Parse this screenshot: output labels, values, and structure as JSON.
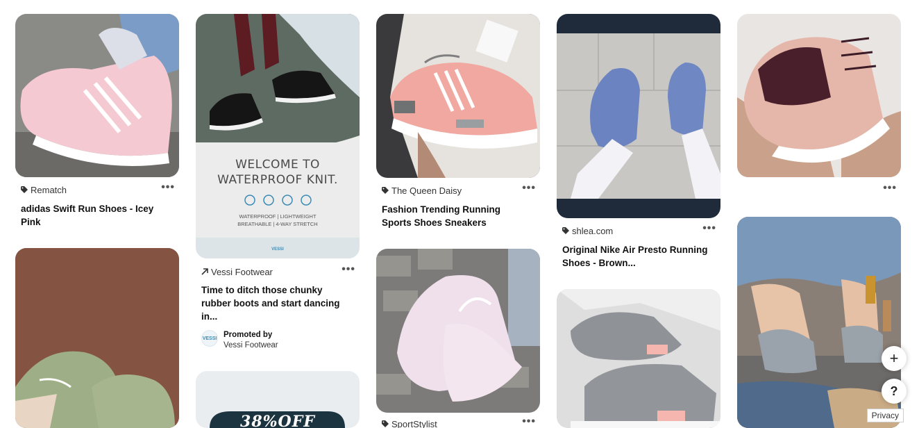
{
  "pins": [
    {
      "source": "Rematch",
      "title": "adidas Swift Run Shoes - Icey Pink"
    },
    {
      "source": "Vessi Footwear",
      "title": "Time to ditch those chunky rubber boots and start dancing in...",
      "promoted_label": "Promoted by",
      "promoted_by": "Vessi Footwear",
      "ad_heading": "WELCOME TO WATERPROOF KNIT.",
      "ad_features": "WATERPROOF | LIGHTWEIGHT BREATHABLE | 4-WAY STRETCH",
      "ad_logo": "VESSI"
    },
    {
      "source": "The Queen Daisy",
      "title": "Fashion Trending Running Sports Shoes Sneakers"
    },
    {
      "source": "shlea.com",
      "title": "Original Nike Air Presto Running Shoes - Brown..."
    },
    {
      "source": "SportStylist",
      "title": ""
    },
    {
      "promo_text": "38%OFF"
    }
  ],
  "controls": {
    "more": "•••",
    "add": "+",
    "help": "?",
    "privacy": "Privacy"
  },
  "icons": [
    "tag-icon",
    "external-link-icon",
    "more-icon",
    "plus-icon",
    "help-icon"
  ],
  "colors": {
    "accent_pink": "#f4c6cf",
    "ad_blue": "#3a8bb5",
    "dark_navy": "#1f2a3b"
  }
}
